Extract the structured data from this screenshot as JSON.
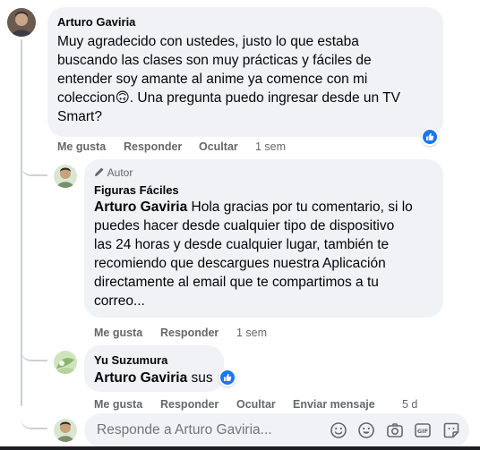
{
  "comment1": {
    "author": "Arturo Gaviria",
    "lines": [
      "Muy agradecido con ustedes, justo lo que estaba",
      "buscando las clases son muy prácticas y fáciles de",
      "entender soy amante al anime ya comence con mi",
      "coleccion",
      ". Una pregunta puedo ingresar desde un TV",
      "Smart?"
    ],
    "emoji": "🙃",
    "actions": {
      "like": "Me gusta",
      "reply": "Responder",
      "hide": "Ocultar",
      "time": "1 sem"
    }
  },
  "reply1": {
    "badge": "Autor",
    "author": "Figuras Fáciles",
    "mention": "Arturo Gaviria",
    "lines": [
      " Hola gracias por tu comentario, si lo",
      "puedes hacer desde cualquier tipo de dispositivo",
      "las 24 horas y desde cualquier lugar, también te",
      "recomiendo que descargues nuestra Aplicación",
      "directamente al email que te compartimos a tu",
      "correo..."
    ],
    "actions": {
      "like": "Me gusta",
      "reply": "Responder",
      "time": "1 sem"
    }
  },
  "reply2": {
    "author": "Yu Suzumura",
    "mention": "Arturo Gaviria",
    "text": " sus",
    "actions": {
      "like": "Me gusta",
      "reply": "Responder",
      "hide": "Ocultar",
      "send": "Enviar mensaje",
      "time": "5 d"
    }
  },
  "composer": {
    "placeholder": "Responde a Arturo Gaviria..."
  },
  "icons": [
    "like-icon",
    "pencil-icon",
    "emoji-sticker-icon",
    "smile-icon",
    "camera-icon",
    "gif-icon",
    "sticker-icon"
  ],
  "colors": {
    "bubble": "#f0f2f5",
    "meta": "#65676b",
    "like_blue": "#1877f2"
  }
}
